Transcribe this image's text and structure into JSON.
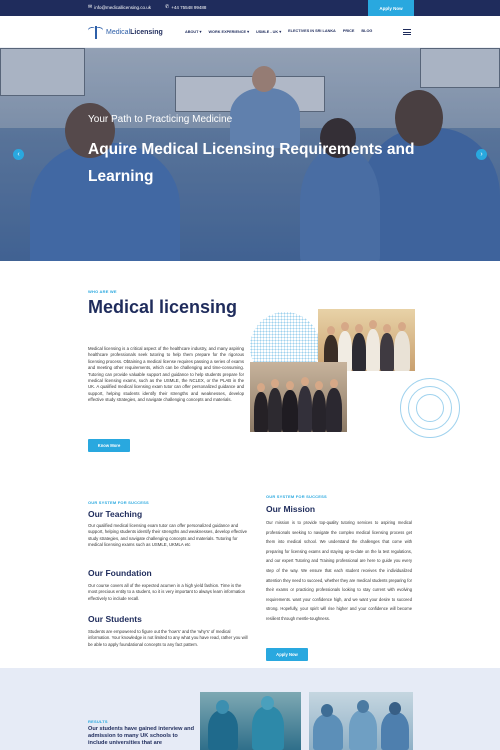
{
  "topbar": {
    "email": "info@medicallicensing.co.uk",
    "phone": "+44 75548 99488",
    "apply_label": "Apply Now"
  },
  "nav": {
    "logo_part1": "Medical",
    "logo_part2": "Licensing",
    "menu": [
      "ABOUT",
      "WORK EXPERIENCE",
      "USMLE - UK",
      "ELECTIVES IN SRI LANKA",
      "PRICE",
      "BLOG"
    ]
  },
  "hero": {
    "subtitle": "Your Path to Practicing Medicine",
    "title": "Aquire Medical Licensing Requirements and Learning"
  },
  "who": {
    "eyebrow": "WHO ARE WE",
    "title": "Medical licensing",
    "body": "Medical licensing is a critical aspect of the healthcare industry, and many aspiring healthcare professionals seek tutoring to help them prepare for the rigorous licensing process. Obtaining a medical license requires passing a series of exams and meeting other requirements, which can be challenging and time-consuming. Tutoring can provide valuable support and guidance to help students prepare for medical licensing exams, such as the USMLE, the NCLEX, or the PLAB in the UK. A qualified medical licensing exam tutor can offer personalized guidance and support, helping students identify their strengths and weaknesses, develop effective study strategies, and navigate challenging concepts and materials.",
    "button_label": "Know More"
  },
  "system": {
    "eyebrow_left": "OUR SYSTEM FOR SUCCESS",
    "teaching_title": "Our Teaching",
    "teaching_body": "Our qualified medical licensing exam tutor can offer personalized guidance and support, helping students identify their strengths and weaknesses, develop effective study strategies, and navigate challenging concepts and materials. Tutoring for medical licensing exams such as USMLE, UKMLA etc",
    "foundation_title": "Our Foundation",
    "foundation_body": "Our course covers all of the expected acumen in a high yield fashion. Time is the most precious entity to a student, so it is very important to always learn information effectively to include recall.",
    "students_title": "Our Students",
    "students_body": "Students are empowered to figure out the 'how's' and the 'why's' of medical information. Your knowledge is not limited to any what you have read, rather you will be able to apply foundational concepts to any fact pattern.",
    "eyebrow_right": "OUR SYSTEM FOR SUCCESS",
    "mission_title": "Our Mission",
    "mission_body": "Our mission is to provide top-quality tutoring services to aspiring medical professionals seeking to navigate the complex medical licensing process get them into medical school. We understand the challenges that come with preparing for licensing exams and staying up-to-date on the la test regulations, and our expert Tutoring and Training professional are here to guide you every step of the way. We ensure that each student receives the individualized attention they need to succeed, whether they are medical students preparing for their exams or practicing professionals looking to stay current with evolving requirements. want your confidence high, and we want your desire to succeed strong. Hopefully, your spirit will rise higher and your confidence will become resilient through mentle-toughness.",
    "mission_button": "Apply Now"
  },
  "results": {
    "eyebrow": "RESULTS",
    "title": "Our students have gained interview and admission to many UK schools to include universities that are"
  },
  "icons": {
    "email": "envelope-icon",
    "phone": "phone-icon",
    "prev": "chevron-left-icon",
    "next": "chevron-right-icon",
    "menu": "hamburger-icon"
  },
  "colors": {
    "navy": "#1f2c5c",
    "accent": "#29a8df",
    "results_bg": "#e6ebf6"
  }
}
